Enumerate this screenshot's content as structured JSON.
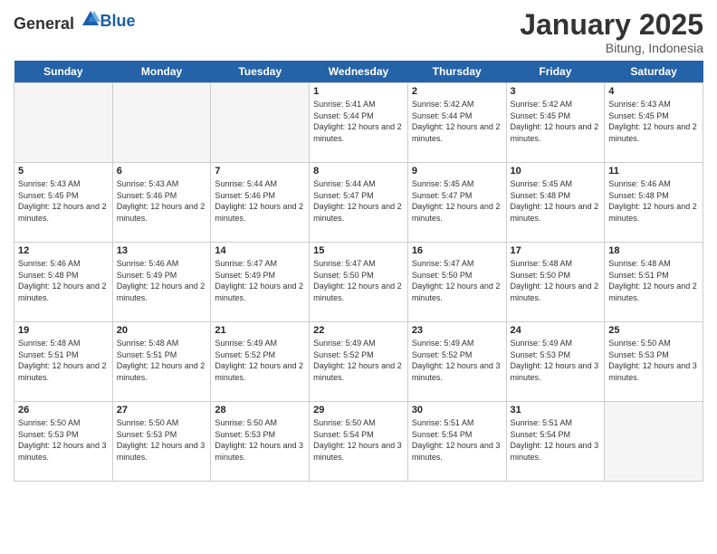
{
  "header": {
    "logo_general": "General",
    "logo_blue": "Blue",
    "month": "January 2025",
    "location": "Bitung, Indonesia"
  },
  "days_of_week": [
    "Sunday",
    "Monday",
    "Tuesday",
    "Wednesday",
    "Thursday",
    "Friday",
    "Saturday"
  ],
  "weeks": [
    [
      {
        "day": "",
        "empty": true
      },
      {
        "day": "",
        "empty": true
      },
      {
        "day": "",
        "empty": true
      },
      {
        "day": "1",
        "sunrise": "5:41 AM",
        "sunset": "5:44 PM",
        "daylight": "12 hours and 2 minutes."
      },
      {
        "day": "2",
        "sunrise": "5:42 AM",
        "sunset": "5:44 PM",
        "daylight": "12 hours and 2 minutes."
      },
      {
        "day": "3",
        "sunrise": "5:42 AM",
        "sunset": "5:45 PM",
        "daylight": "12 hours and 2 minutes."
      },
      {
        "day": "4",
        "sunrise": "5:43 AM",
        "sunset": "5:45 PM",
        "daylight": "12 hours and 2 minutes."
      }
    ],
    [
      {
        "day": "5",
        "sunrise": "5:43 AM",
        "sunset": "5:45 PM",
        "daylight": "12 hours and 2 minutes."
      },
      {
        "day": "6",
        "sunrise": "5:43 AM",
        "sunset": "5:46 PM",
        "daylight": "12 hours and 2 minutes."
      },
      {
        "day": "7",
        "sunrise": "5:44 AM",
        "sunset": "5:46 PM",
        "daylight": "12 hours and 2 minutes."
      },
      {
        "day": "8",
        "sunrise": "5:44 AM",
        "sunset": "5:47 PM",
        "daylight": "12 hours and 2 minutes."
      },
      {
        "day": "9",
        "sunrise": "5:45 AM",
        "sunset": "5:47 PM",
        "daylight": "12 hours and 2 minutes."
      },
      {
        "day": "10",
        "sunrise": "5:45 AM",
        "sunset": "5:48 PM",
        "daylight": "12 hours and 2 minutes."
      },
      {
        "day": "11",
        "sunrise": "5:46 AM",
        "sunset": "5:48 PM",
        "daylight": "12 hours and 2 minutes."
      }
    ],
    [
      {
        "day": "12",
        "sunrise": "5:46 AM",
        "sunset": "5:48 PM",
        "daylight": "12 hours and 2 minutes."
      },
      {
        "day": "13",
        "sunrise": "5:46 AM",
        "sunset": "5:49 PM",
        "daylight": "12 hours and 2 minutes."
      },
      {
        "day": "14",
        "sunrise": "5:47 AM",
        "sunset": "5:49 PM",
        "daylight": "12 hours and 2 minutes."
      },
      {
        "day": "15",
        "sunrise": "5:47 AM",
        "sunset": "5:50 PM",
        "daylight": "12 hours and 2 minutes."
      },
      {
        "day": "16",
        "sunrise": "5:47 AM",
        "sunset": "5:50 PM",
        "daylight": "12 hours and 2 minutes."
      },
      {
        "day": "17",
        "sunrise": "5:48 AM",
        "sunset": "5:50 PM",
        "daylight": "12 hours and 2 minutes."
      },
      {
        "day": "18",
        "sunrise": "5:48 AM",
        "sunset": "5:51 PM",
        "daylight": "12 hours and 2 minutes."
      }
    ],
    [
      {
        "day": "19",
        "sunrise": "5:48 AM",
        "sunset": "5:51 PM",
        "daylight": "12 hours and 2 minutes."
      },
      {
        "day": "20",
        "sunrise": "5:48 AM",
        "sunset": "5:51 PM",
        "daylight": "12 hours and 2 minutes."
      },
      {
        "day": "21",
        "sunrise": "5:49 AM",
        "sunset": "5:52 PM",
        "daylight": "12 hours and 2 minutes."
      },
      {
        "day": "22",
        "sunrise": "5:49 AM",
        "sunset": "5:52 PM",
        "daylight": "12 hours and 2 minutes."
      },
      {
        "day": "23",
        "sunrise": "5:49 AM",
        "sunset": "5:52 PM",
        "daylight": "12 hours and 3 minutes."
      },
      {
        "day": "24",
        "sunrise": "5:49 AM",
        "sunset": "5:53 PM",
        "daylight": "12 hours and 3 minutes."
      },
      {
        "day": "25",
        "sunrise": "5:50 AM",
        "sunset": "5:53 PM",
        "daylight": "12 hours and 3 minutes."
      }
    ],
    [
      {
        "day": "26",
        "sunrise": "5:50 AM",
        "sunset": "5:53 PM",
        "daylight": "12 hours and 3 minutes."
      },
      {
        "day": "27",
        "sunrise": "5:50 AM",
        "sunset": "5:53 PM",
        "daylight": "12 hours and 3 minutes."
      },
      {
        "day": "28",
        "sunrise": "5:50 AM",
        "sunset": "5:53 PM",
        "daylight": "12 hours and 3 minutes."
      },
      {
        "day": "29",
        "sunrise": "5:50 AM",
        "sunset": "5:54 PM",
        "daylight": "12 hours and 3 minutes."
      },
      {
        "day": "30",
        "sunrise": "5:51 AM",
        "sunset": "5:54 PM",
        "daylight": "12 hours and 3 minutes."
      },
      {
        "day": "31",
        "sunrise": "5:51 AM",
        "sunset": "5:54 PM",
        "daylight": "12 hours and 3 minutes."
      },
      {
        "day": "",
        "empty": true
      }
    ]
  ]
}
